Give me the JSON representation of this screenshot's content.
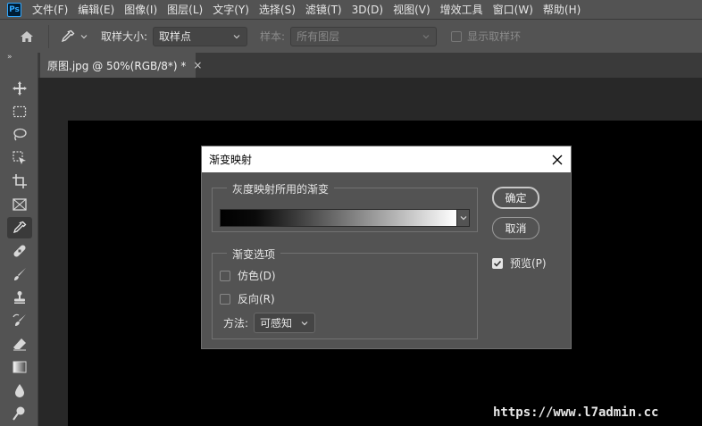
{
  "app": {
    "logo": "Ps"
  },
  "menu": [
    "文件(F)",
    "编辑(E)",
    "图像(I)",
    "图层(L)",
    "文字(Y)",
    "选择(S)",
    "滤镜(T)",
    "3D(D)",
    "视图(V)",
    "增效工具",
    "窗口(W)",
    "帮助(H)"
  ],
  "options": {
    "sample_size_label": "取样大小:",
    "sample_size_value": "取样点",
    "sample_label": "样本:",
    "sample_value": "所有图层",
    "show_ring_label": "显示取样环"
  },
  "toolbar": {
    "collapse": "»",
    "active_tool": "eyedropper-tool"
  },
  "document": {
    "tab_title": "原图.jpg @ 50%(RGB/8*) *",
    "close": "×"
  },
  "dialog": {
    "title": "渐变映射",
    "close": "×",
    "gradient_group_label": "灰度映射所用的渐变",
    "options_group_label": "渐变选项",
    "dither_label": "仿色(D)",
    "reverse_label": "反向(R)",
    "method_label": "方法:",
    "method_value": "可感知",
    "ok_label": "确定",
    "cancel_label": "取消",
    "preview_label": "预览(P)",
    "dither_checked": false,
    "reverse_checked": false,
    "preview_checked": true
  },
  "watermark": "https://www.l7admin.cc",
  "colors": {
    "ui_panel": "#535353",
    "workspace": "#282828",
    "canvas": "#000000",
    "ps_logo_bg": "#001e36",
    "ps_logo_fg": "#31a8ff"
  }
}
